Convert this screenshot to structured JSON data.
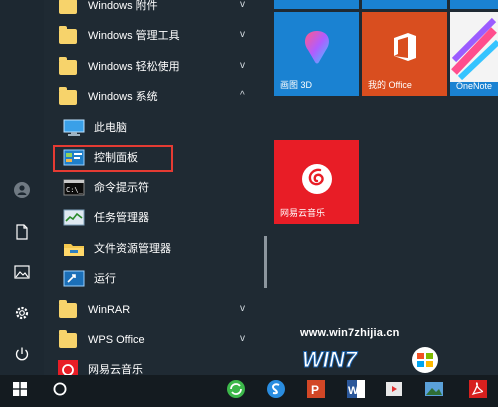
{
  "app_list": {
    "items": [
      {
        "label": "Windows 附件"
      },
      {
        "label": "Windows 管理工具"
      },
      {
        "label": "Windows 轻松使用"
      },
      {
        "label": "Windows 系统"
      },
      {
        "label": "此电脑"
      },
      {
        "label": "控制面板"
      },
      {
        "label": "命令提示符"
      },
      {
        "label": "任务管理器"
      },
      {
        "label": "文件资源管理器"
      },
      {
        "label": "运行"
      },
      {
        "label": "WinRAR"
      },
      {
        "label": "WPS Office"
      },
      {
        "label": "网易云音乐"
      }
    ],
    "expanded_chevron": "^",
    "collapsed_chevron": "v"
  },
  "tiles": {
    "paint3d": {
      "label": "画图 3D"
    },
    "office": {
      "label": "我的 Office"
    },
    "onenote": {
      "label": "OneNote"
    },
    "netease": {
      "label": "网易云音乐"
    }
  },
  "watermark": {
    "url": "www.win7zhijia.cn",
    "logo": "WIN7"
  },
  "colors": {
    "background": "#1f2a33",
    "accent_blue": "#1a82d2",
    "office_orange": "#d94e1f",
    "netease_red": "#e81d26",
    "highlight_red": "#e53b33",
    "folder_yellow": "#f7d36b"
  },
  "icons": {
    "user": "user-avatar-icon",
    "documents": "document-icon",
    "pictures": "pictures-icon",
    "settings": "gear-icon",
    "power": "power-icon",
    "start": "windows-logo-icon",
    "cortana": "cortana-circle-icon"
  }
}
